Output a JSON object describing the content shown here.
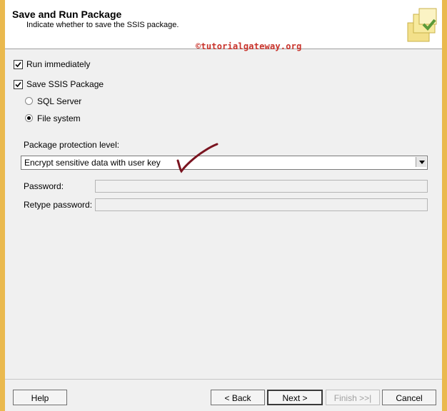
{
  "header": {
    "title": "Save and Run Package",
    "subtitle": "Indicate whether to save the SSIS package."
  },
  "watermark": "©tutorialgateway.org",
  "options": {
    "run_immediately": {
      "label": "Run immediately",
      "checked": true
    },
    "save_package": {
      "label": "Save SSIS Package",
      "checked": true
    },
    "sql_server": {
      "label": "SQL Server",
      "selected": false
    },
    "file_system": {
      "label": "File system",
      "selected": true
    }
  },
  "protection": {
    "label": "Package protection level:",
    "value": "Encrypt sensitive data with user key"
  },
  "password": {
    "label": "Password:",
    "value": ""
  },
  "retype_password": {
    "label": "Retype password:",
    "value": ""
  },
  "buttons": {
    "help": "Help",
    "back": "< Back",
    "next": "Next >",
    "finish": "Finish >>|",
    "cancel": "Cancel"
  },
  "colors": {
    "window_border": "#eab94e",
    "annotation": "#7a1420",
    "watermark": "#c8322a"
  }
}
